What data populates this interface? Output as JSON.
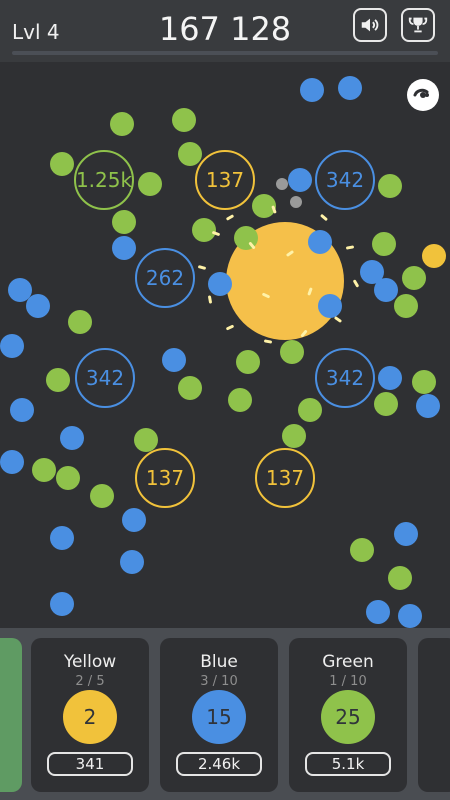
{
  "header": {
    "level_label": "Lvl 4",
    "score": "167 128",
    "sound_icon": "speaker-icon",
    "trophy_icon": "trophy-icon"
  },
  "playfield": {
    "theme_icon": "moon-eye-icon",
    "targets": [
      {
        "label": "1.25k",
        "color": "green"
      },
      {
        "label": "137",
        "color": "yellow"
      },
      {
        "label": "342",
        "color": "blue"
      },
      {
        "label": "262",
        "color": "blue"
      },
      {
        "label": "342",
        "color": "blue"
      },
      {
        "label": "342",
        "color": "blue"
      },
      {
        "label": "137",
        "color": "yellow"
      },
      {
        "label": "137",
        "color": "yellow"
      }
    ]
  },
  "cards": [
    {
      "title": "Yellow",
      "progress": "2 / 5",
      "value": "2",
      "cost": "341",
      "color": "#f1c23b"
    },
    {
      "title": "Blue",
      "progress": "3 / 10",
      "value": "15",
      "cost": "2.46k",
      "color": "#4a8fe2"
    },
    {
      "title": "Green",
      "progress": "1 / 10",
      "value": "25",
      "cost": "5.1k",
      "color": "#8fc24b"
    }
  ],
  "colors": {
    "background": "#2f3033",
    "green": "#8fc24b",
    "blue": "#4a8fe2",
    "yellow": "#f1c23b"
  }
}
